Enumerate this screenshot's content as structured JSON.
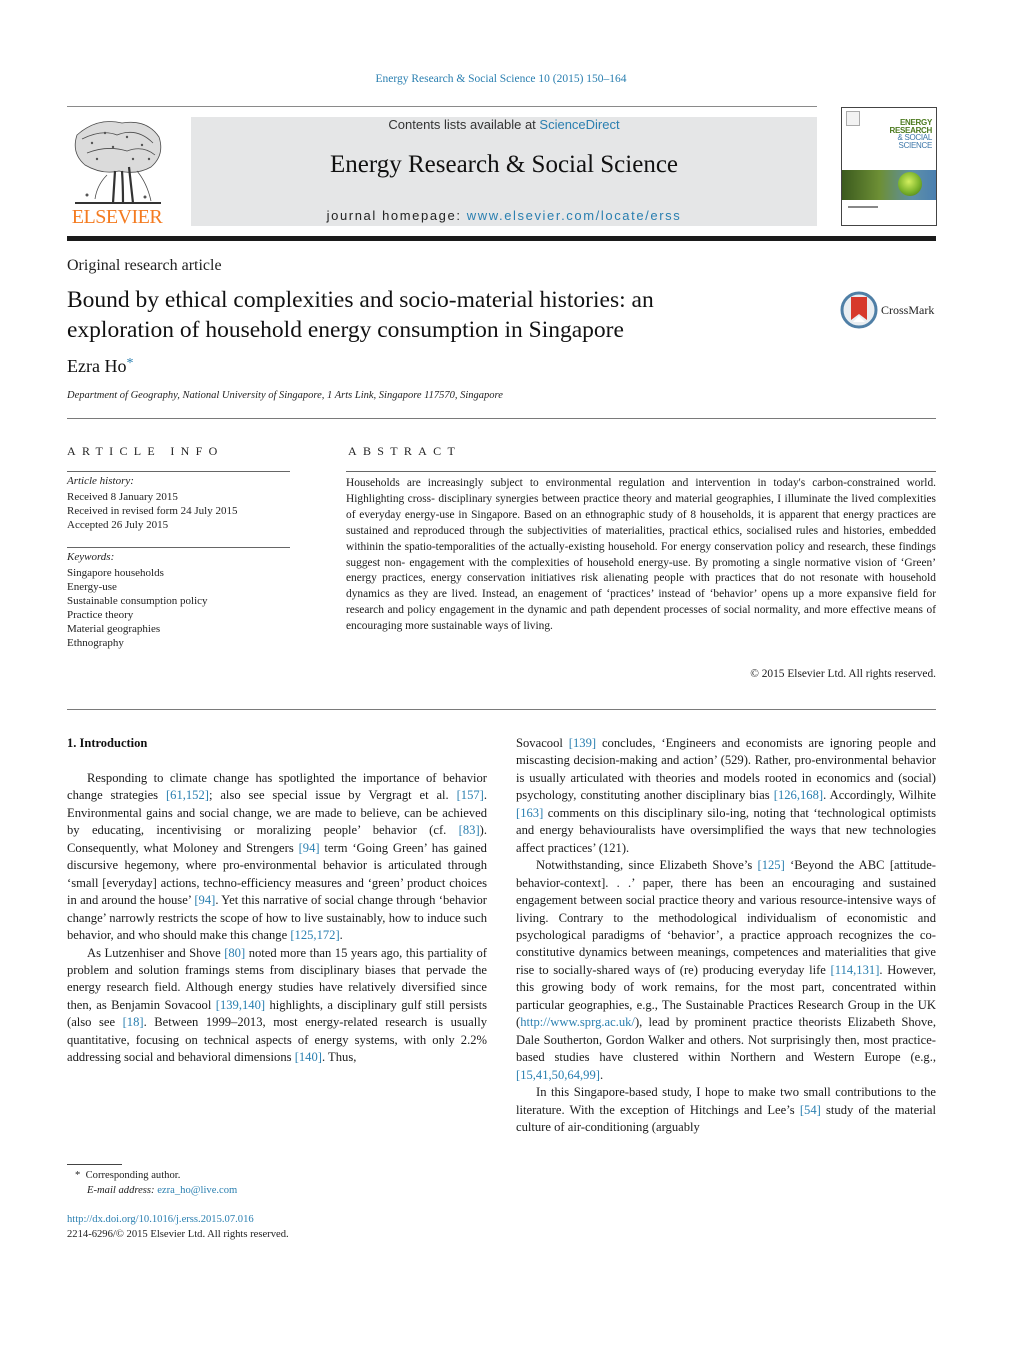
{
  "header": {
    "journal_citation": "Energy Research & Social Science 10 (2015) 150–164",
    "contents_prefix": "Contents lists available at ",
    "contents_link": "ScienceDirect",
    "journal_title": "Energy Research & Social Science",
    "homepage_prefix": "journal homepage: ",
    "homepage_link": "www.elsevier.com/locate/erss",
    "publisher_logo_text": "ELSEVIER",
    "cover": {
      "line1": "ENERGY",
      "line2": "RESEARCH",
      "line3": "& SOCIAL",
      "line4": "SCIENCE"
    },
    "colors": {
      "link": "#2a7fb0",
      "elsevier_orange": "#f47b20",
      "masthead_grey": "#e5e6e7"
    }
  },
  "article": {
    "type": "Original research article",
    "title_line1": "Bound by ethical complexities and socio-material histories: an",
    "title_line2": "exploration of household energy consumption in Singapore",
    "crossmark_label": "CrossMark",
    "author": "Ezra Ho",
    "author_marker": "*",
    "affiliation": "Department of Geography, National University of Singapore, 1 Arts Link, Singapore 117570, Singapore"
  },
  "article_info": {
    "heading": "ARTICLE INFO",
    "history_label": "Article history:",
    "history": [
      "Received 8 January 2015",
      "Received in revised form 24 July 2015",
      "Accepted 26 July 2015"
    ],
    "keywords_label": "Keywords:",
    "keywords": [
      "Singapore households",
      "Energy-use",
      "Sustainable consumption policy",
      "Practice theory",
      "Material geographies",
      "Ethnography"
    ]
  },
  "abstract": {
    "heading": "ABSTRACT",
    "text": "Households are increasingly subject to environmental regulation and intervention in today's carbon-constrained world. Highlighting cross- disciplinary synergies between practice theory and material geographies, I illuminate the lived complexities of everyday energy-use in Singapore. Based on an ethnographic study of 8 households, it is apparent that energy practices are sustained and reproduced through the subjectivities of materialities, practical ethics, socialised rules and histories, embedded withinin the spatio-temporalities of the actually-existing household. For energy conservation policy and research, these findings suggest non- engagement with the complexities of household energy-use. By promoting a single normative vision of ‘Green’ energy practices, energy conservation initiatives risk alienating people with practices that do not resonate with household dynamics as they are lived. Instead, an enagement of ‘practices’ instead of ‘behavior’ opens up a more expansive field for research and policy engagement in the dynamic and path dependent processes of social normality, and more effective means of encouraging more sustainable ways of living.",
    "copyright": "© 2015 Elsevier Ltd. All rights reserved."
  },
  "body": {
    "section_heading": "1.  Introduction",
    "left_column": [
      {
        "indent": true,
        "segments": [
          {
            "t": "Responding to climate change has spotlighted the importance of behavior change strategies "
          },
          {
            "t": "[61,152]",
            "link": true
          },
          {
            "t": "; also see special issue by Vergragt et al. "
          },
          {
            "t": "[157]",
            "link": true
          },
          {
            "t": ". Environmental gains and social change, we are made to believe, can be achieved by educating, incentivising or moralizing people’ behavior (cf. "
          },
          {
            "t": "[83]",
            "link": true
          },
          {
            "t": "). Consequently, what Moloney and Strengers "
          },
          {
            "t": "[94]",
            "link": true
          },
          {
            "t": " term ‘Going Green’ has gained discursive hegemony, where pro-environmental behavior is articulated through ‘small [everyday] actions, techno-efficiency measures and ‘green’ product choices in and around the house’ "
          },
          {
            "t": "[94]",
            "link": true
          },
          {
            "t": ". Yet this narrative of social change through ‘behavior change’ narrowly restricts the scope of how to live sustainably, how to induce such behavior, and who should make this change "
          },
          {
            "t": "[125,172]",
            "link": true
          },
          {
            "t": "."
          }
        ]
      },
      {
        "indent": true,
        "segments": [
          {
            "t": "As Lutzenhiser and Shove "
          },
          {
            "t": "[80]",
            "link": true
          },
          {
            "t": " noted more than 15 years ago, this partiality of problem and solution framings stems from disciplinary biases that pervade the energy research field. Although energy studies have relatively diversified since then, as Benjamin Sovacool "
          },
          {
            "t": "[139,140]",
            "link": true
          },
          {
            "t": " highlights, a disciplinary gulf still persists (also see "
          },
          {
            "t": "[18]",
            "link": true
          },
          {
            "t": ". Between 1999–2013, most energy-related research is usually quantitative, focusing on technical aspects of energy systems, with only 2.2% addressing social and behavioral dimensions "
          },
          {
            "t": "[140]",
            "link": true
          },
          {
            "t": ". Thus,"
          }
        ]
      }
    ],
    "right_column": [
      {
        "indent": false,
        "segments": [
          {
            "t": "Sovacool "
          },
          {
            "t": "[139]",
            "link": true
          },
          {
            "t": " concludes, ‘Engineers and economists are ignoring people and miscasting decision-making and action’ (529). Rather, pro-environmental behavior is usually articulated with theories and models rooted in economics and (social) psychology, constituting another disciplinary bias "
          },
          {
            "t": "[126,168]",
            "link": true
          },
          {
            "t": ". Accordingly, Wilhite "
          },
          {
            "t": "[163]",
            "link": true
          },
          {
            "t": " comments on this disciplinary silo-ing, noting that ‘technological optimists and energy behaviouralists have oversimplified the ways that new technologies affect practices’ (121)."
          }
        ]
      },
      {
        "indent": true,
        "segments": [
          {
            "t": "Notwithstanding, since Elizabeth Shove’s "
          },
          {
            "t": "[125]",
            "link": true
          },
          {
            "t": " ‘Beyond the ABC [attitude-behavior-context]. . .’ paper, there has been an encouraging and sustained engagement between social practice theory and various resource-intensive ways of living. Contrary to the methodological individualism of economistic and psychological paradigms of ‘behavior’, a practice approach recognizes the co-constitutive dynamics between meanings, competences and materialities that give rise to socially-shared ways of (re) producing everyday life "
          },
          {
            "t": "[114,131]",
            "link": true
          },
          {
            "t": ". However, this growing body of work remains, for the most part, concentrated within particular geographies, e.g., The Sustainable Practices Research Group in the UK ("
          },
          {
            "t": "http://www.sprg.ac.uk/",
            "link": true
          },
          {
            "t": "), lead by prominent practice theorists Elizabeth Shove, Dale Southerton, Gordon Walker and others. Not surprisingly then, most practice-based studies have clustered within Northern and Western Europe (e.g., "
          },
          {
            "t": "[15,41,50,64,99]",
            "link": true
          },
          {
            "t": "."
          }
        ]
      },
      {
        "indent": true,
        "segments": [
          {
            "t": "In this Singapore-based study, I hope to make two small contributions to the literature. With the exception of Hitchings and Lee’s "
          },
          {
            "t": "[54]",
            "link": true
          },
          {
            "t": " study of the material culture of air-conditioning (arguably"
          }
        ]
      }
    ]
  },
  "footer": {
    "footnote_marker": "*",
    "corresponding": "Corresponding author.",
    "email_label": "E-mail address: ",
    "email": "ezra_ho@live.com",
    "doi_link": "http://dx.doi.org/10.1016/j.erss.2015.07.016",
    "issn_line": "2214-6296/© 2015 Elsevier Ltd. All rights reserved."
  }
}
